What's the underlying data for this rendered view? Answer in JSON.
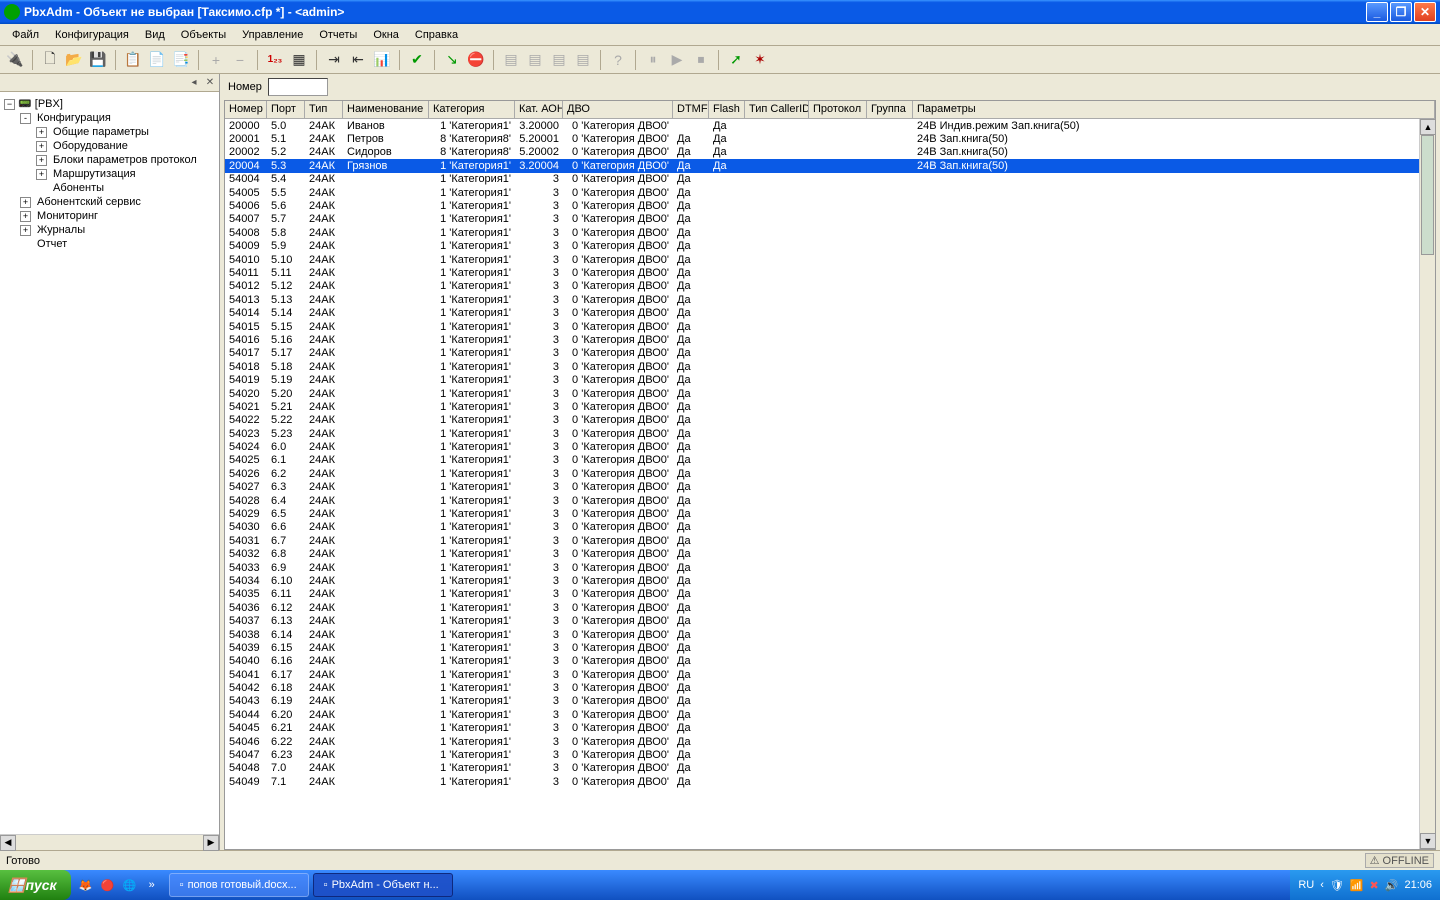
{
  "window": {
    "title": "PbxAdm  -  Объект не выбран [Таксимо.cfp *]   - <admin>"
  },
  "menu": {
    "items": [
      "Файл",
      "Конфигурация",
      "Вид",
      "Объекты",
      "Управление",
      "Отчеты",
      "Окна",
      "Справка"
    ]
  },
  "tree": {
    "root": "[PBX]",
    "nodes": [
      {
        "d": 1,
        "exp": "-",
        "label": "Конфигурация"
      },
      {
        "d": 2,
        "exp": "+",
        "label": "Общие параметры"
      },
      {
        "d": 2,
        "exp": "+",
        "label": "Оборудование"
      },
      {
        "d": 2,
        "exp": "+",
        "label": "Блоки параметров протокол"
      },
      {
        "d": 2,
        "exp": "+",
        "label": "Маршрутизация"
      },
      {
        "d": 2,
        "exp": "",
        "label": "Абоненты"
      },
      {
        "d": 1,
        "exp": "+",
        "label": "Абонентский сервис"
      },
      {
        "d": 1,
        "exp": "+",
        "label": "Мониторинг"
      },
      {
        "d": 1,
        "exp": "+",
        "label": "Журналы"
      },
      {
        "d": 1,
        "exp": "",
        "label": "Отчет"
      }
    ]
  },
  "filter": {
    "label": "Номер",
    "value": ""
  },
  "grid": {
    "columns": [
      "Номер",
      "Порт",
      "Тип",
      "Наименование",
      "Категория",
      "Кат. АОН",
      "ДВО",
      "DTMF",
      "Flash",
      "Тип CallerID",
      "Протокол",
      "Группа",
      "Параметры"
    ],
    "selected_index": 3,
    "rows": [
      {
        "nom": "20000",
        "por": "5.0",
        "tip": "24АК",
        "nam": "Иванов",
        "kat": "1 'Категория1'",
        "aon": "3.20000",
        "dvo": "0 'Категория ДВО0'",
        "dtm": "",
        "fla": "Да",
        "par": "24В  Индив.режим Зап.книга(50)"
      },
      {
        "nom": "20001",
        "por": "5.1",
        "tip": "24АК",
        "nam": "Петров",
        "kat": "8 'Категория8'",
        "aon": "5.20001",
        "dvo": "0 'Категория ДВО0'",
        "dtm": "Да",
        "fla": "Да",
        "par": "24В  Зап.книга(50)"
      },
      {
        "nom": "20002",
        "por": "5.2",
        "tip": "24АК",
        "nam": "Сидоров",
        "kat": "8 'Категория8'",
        "aon": "5.20002",
        "dvo": "0 'Категория ДВО0'",
        "dtm": "Да",
        "fla": "Да",
        "par": "24В  Зап.книга(50)"
      },
      {
        "nom": "20004",
        "por": "5.3",
        "tip": "24АК",
        "nam": "Грязнов",
        "kat": "1 'Категория1'",
        "aon": "3.20004",
        "dvo": "0 'Категория ДВО0'",
        "dtm": "Да",
        "fla": "Да",
        "par": "24В  Зап.книга(50)"
      },
      {
        "nom": "54004",
        "por": "5.4",
        "tip": "24АК",
        "nam": "",
        "kat": "1 'Категория1'",
        "aon": "3",
        "dvo": "0 'Категория ДВО0'",
        "dtm": "Да",
        "fla": "",
        "par": ""
      },
      {
        "nom": "54005",
        "por": "5.5",
        "tip": "24АК",
        "nam": "",
        "kat": "1 'Категория1'",
        "aon": "3",
        "dvo": "0 'Категория ДВО0'",
        "dtm": "Да",
        "fla": "",
        "par": ""
      },
      {
        "nom": "54006",
        "por": "5.6",
        "tip": "24АК",
        "nam": "",
        "kat": "1 'Категория1'",
        "aon": "3",
        "dvo": "0 'Категория ДВО0'",
        "dtm": "Да",
        "fla": "",
        "par": ""
      },
      {
        "nom": "54007",
        "por": "5.7",
        "tip": "24АК",
        "nam": "",
        "kat": "1 'Категория1'",
        "aon": "3",
        "dvo": "0 'Категория ДВО0'",
        "dtm": "Да",
        "fla": "",
        "par": ""
      },
      {
        "nom": "54008",
        "por": "5.8",
        "tip": "24АК",
        "nam": "",
        "kat": "1 'Категория1'",
        "aon": "3",
        "dvo": "0 'Категория ДВО0'",
        "dtm": "Да",
        "fla": "",
        "par": ""
      },
      {
        "nom": "54009",
        "por": "5.9",
        "tip": "24АК",
        "nam": "",
        "kat": "1 'Категория1'",
        "aon": "3",
        "dvo": "0 'Категория ДВО0'",
        "dtm": "Да",
        "fla": "",
        "par": ""
      },
      {
        "nom": "54010",
        "por": "5.10",
        "tip": "24АК",
        "nam": "",
        "kat": "1 'Категория1'",
        "aon": "3",
        "dvo": "0 'Категория ДВО0'",
        "dtm": "Да",
        "fla": "",
        "par": ""
      },
      {
        "nom": "54011",
        "por": "5.11",
        "tip": "24АК",
        "nam": "",
        "kat": "1 'Категория1'",
        "aon": "3",
        "dvo": "0 'Категория ДВО0'",
        "dtm": "Да",
        "fla": "",
        "par": ""
      },
      {
        "nom": "54012",
        "por": "5.12",
        "tip": "24АК",
        "nam": "",
        "kat": "1 'Категория1'",
        "aon": "3",
        "dvo": "0 'Категория ДВО0'",
        "dtm": "Да",
        "fla": "",
        "par": ""
      },
      {
        "nom": "54013",
        "por": "5.13",
        "tip": "24АК",
        "nam": "",
        "kat": "1 'Категория1'",
        "aon": "3",
        "dvo": "0 'Категория ДВО0'",
        "dtm": "Да",
        "fla": "",
        "par": ""
      },
      {
        "nom": "54014",
        "por": "5.14",
        "tip": "24АК",
        "nam": "",
        "kat": "1 'Категория1'",
        "aon": "3",
        "dvo": "0 'Категория ДВО0'",
        "dtm": "Да",
        "fla": "",
        "par": ""
      },
      {
        "nom": "54015",
        "por": "5.15",
        "tip": "24АК",
        "nam": "",
        "kat": "1 'Категория1'",
        "aon": "3",
        "dvo": "0 'Категория ДВО0'",
        "dtm": "Да",
        "fla": "",
        "par": ""
      },
      {
        "nom": "54016",
        "por": "5.16",
        "tip": "24АК",
        "nam": "",
        "kat": "1 'Категория1'",
        "aon": "3",
        "dvo": "0 'Категория ДВО0'",
        "dtm": "Да",
        "fla": "",
        "par": ""
      },
      {
        "nom": "54017",
        "por": "5.17",
        "tip": "24АК",
        "nam": "",
        "kat": "1 'Категория1'",
        "aon": "3",
        "dvo": "0 'Категория ДВО0'",
        "dtm": "Да",
        "fla": "",
        "par": ""
      },
      {
        "nom": "54018",
        "por": "5.18",
        "tip": "24АК",
        "nam": "",
        "kat": "1 'Категория1'",
        "aon": "3",
        "dvo": "0 'Категория ДВО0'",
        "dtm": "Да",
        "fla": "",
        "par": ""
      },
      {
        "nom": "54019",
        "por": "5.19",
        "tip": "24АК",
        "nam": "",
        "kat": "1 'Категория1'",
        "aon": "3",
        "dvo": "0 'Категория ДВО0'",
        "dtm": "Да",
        "fla": "",
        "par": ""
      },
      {
        "nom": "54020",
        "por": "5.20",
        "tip": "24АК",
        "nam": "",
        "kat": "1 'Категория1'",
        "aon": "3",
        "dvo": "0 'Категория ДВО0'",
        "dtm": "Да",
        "fla": "",
        "par": ""
      },
      {
        "nom": "54021",
        "por": "5.21",
        "tip": "24АК",
        "nam": "",
        "kat": "1 'Категория1'",
        "aon": "3",
        "dvo": "0 'Категория ДВО0'",
        "dtm": "Да",
        "fla": "",
        "par": ""
      },
      {
        "nom": "54022",
        "por": "5.22",
        "tip": "24АК",
        "nam": "",
        "kat": "1 'Категория1'",
        "aon": "3",
        "dvo": "0 'Категория ДВО0'",
        "dtm": "Да",
        "fla": "",
        "par": ""
      },
      {
        "nom": "54023",
        "por": "5.23",
        "tip": "24АК",
        "nam": "",
        "kat": "1 'Категория1'",
        "aon": "3",
        "dvo": "0 'Категория ДВО0'",
        "dtm": "Да",
        "fla": "",
        "par": ""
      },
      {
        "nom": "54024",
        "por": "6.0",
        "tip": "24АК",
        "nam": "",
        "kat": "1 'Категория1'",
        "aon": "3",
        "dvo": "0 'Категория ДВО0'",
        "dtm": "Да",
        "fla": "",
        "par": ""
      },
      {
        "nom": "54025",
        "por": "6.1",
        "tip": "24АК",
        "nam": "",
        "kat": "1 'Категория1'",
        "aon": "3",
        "dvo": "0 'Категория ДВО0'",
        "dtm": "Да",
        "fla": "",
        "par": ""
      },
      {
        "nom": "54026",
        "por": "6.2",
        "tip": "24АК",
        "nam": "",
        "kat": "1 'Категория1'",
        "aon": "3",
        "dvo": "0 'Категория ДВО0'",
        "dtm": "Да",
        "fla": "",
        "par": ""
      },
      {
        "nom": "54027",
        "por": "6.3",
        "tip": "24АК",
        "nam": "",
        "kat": "1 'Категория1'",
        "aon": "3",
        "dvo": "0 'Категория ДВО0'",
        "dtm": "Да",
        "fla": "",
        "par": ""
      },
      {
        "nom": "54028",
        "por": "6.4",
        "tip": "24АК",
        "nam": "",
        "kat": "1 'Категория1'",
        "aon": "3",
        "dvo": "0 'Категория ДВО0'",
        "dtm": "Да",
        "fla": "",
        "par": ""
      },
      {
        "nom": "54029",
        "por": "6.5",
        "tip": "24АК",
        "nam": "",
        "kat": "1 'Категория1'",
        "aon": "3",
        "dvo": "0 'Категория ДВО0'",
        "dtm": "Да",
        "fla": "",
        "par": ""
      },
      {
        "nom": "54030",
        "por": "6.6",
        "tip": "24АК",
        "nam": "",
        "kat": "1 'Категория1'",
        "aon": "3",
        "dvo": "0 'Категория ДВО0'",
        "dtm": "Да",
        "fla": "",
        "par": ""
      },
      {
        "nom": "54031",
        "por": "6.7",
        "tip": "24АК",
        "nam": "",
        "kat": "1 'Категория1'",
        "aon": "3",
        "dvo": "0 'Категория ДВО0'",
        "dtm": "Да",
        "fla": "",
        "par": ""
      },
      {
        "nom": "54032",
        "por": "6.8",
        "tip": "24АК",
        "nam": "",
        "kat": "1 'Категория1'",
        "aon": "3",
        "dvo": "0 'Категория ДВО0'",
        "dtm": "Да",
        "fla": "",
        "par": ""
      },
      {
        "nom": "54033",
        "por": "6.9",
        "tip": "24АК",
        "nam": "",
        "kat": "1 'Категория1'",
        "aon": "3",
        "dvo": "0 'Категория ДВО0'",
        "dtm": "Да",
        "fla": "",
        "par": ""
      },
      {
        "nom": "54034",
        "por": "6.10",
        "tip": "24АК",
        "nam": "",
        "kat": "1 'Категория1'",
        "aon": "3",
        "dvo": "0 'Категория ДВО0'",
        "dtm": "Да",
        "fla": "",
        "par": ""
      },
      {
        "nom": "54035",
        "por": "6.11",
        "tip": "24АК",
        "nam": "",
        "kat": "1 'Категория1'",
        "aon": "3",
        "dvo": "0 'Категория ДВО0'",
        "dtm": "Да",
        "fla": "",
        "par": ""
      },
      {
        "nom": "54036",
        "por": "6.12",
        "tip": "24АК",
        "nam": "",
        "kat": "1 'Категория1'",
        "aon": "3",
        "dvo": "0 'Категория ДВО0'",
        "dtm": "Да",
        "fla": "",
        "par": ""
      },
      {
        "nom": "54037",
        "por": "6.13",
        "tip": "24АК",
        "nam": "",
        "kat": "1 'Категория1'",
        "aon": "3",
        "dvo": "0 'Категория ДВО0'",
        "dtm": "Да",
        "fla": "",
        "par": ""
      },
      {
        "nom": "54038",
        "por": "6.14",
        "tip": "24АК",
        "nam": "",
        "kat": "1 'Категория1'",
        "aon": "3",
        "dvo": "0 'Категория ДВО0'",
        "dtm": "Да",
        "fla": "",
        "par": ""
      },
      {
        "nom": "54039",
        "por": "6.15",
        "tip": "24АК",
        "nam": "",
        "kat": "1 'Категория1'",
        "aon": "3",
        "dvo": "0 'Категория ДВО0'",
        "dtm": "Да",
        "fla": "",
        "par": ""
      },
      {
        "nom": "54040",
        "por": "6.16",
        "tip": "24АК",
        "nam": "",
        "kat": "1 'Категория1'",
        "aon": "3",
        "dvo": "0 'Категория ДВО0'",
        "dtm": "Да",
        "fla": "",
        "par": ""
      },
      {
        "nom": "54041",
        "por": "6.17",
        "tip": "24АК",
        "nam": "",
        "kat": "1 'Категория1'",
        "aon": "3",
        "dvo": "0 'Категория ДВО0'",
        "dtm": "Да",
        "fla": "",
        "par": ""
      },
      {
        "nom": "54042",
        "por": "6.18",
        "tip": "24АК",
        "nam": "",
        "kat": "1 'Категория1'",
        "aon": "3",
        "dvo": "0 'Категория ДВО0'",
        "dtm": "Да",
        "fla": "",
        "par": ""
      },
      {
        "nom": "54043",
        "por": "6.19",
        "tip": "24АК",
        "nam": "",
        "kat": "1 'Категория1'",
        "aon": "3",
        "dvo": "0 'Категория ДВО0'",
        "dtm": "Да",
        "fla": "",
        "par": ""
      },
      {
        "nom": "54044",
        "por": "6.20",
        "tip": "24АК",
        "nam": "",
        "kat": "1 'Категория1'",
        "aon": "3",
        "dvo": "0 'Категория ДВО0'",
        "dtm": "Да",
        "fla": "",
        "par": ""
      },
      {
        "nom": "54045",
        "por": "6.21",
        "tip": "24АК",
        "nam": "",
        "kat": "1 'Категория1'",
        "aon": "3",
        "dvo": "0 'Категория ДВО0'",
        "dtm": "Да",
        "fla": "",
        "par": ""
      },
      {
        "nom": "54046",
        "por": "6.22",
        "tip": "24АК",
        "nam": "",
        "kat": "1 'Категория1'",
        "aon": "3",
        "dvo": "0 'Категория ДВО0'",
        "dtm": "Да",
        "fla": "",
        "par": ""
      },
      {
        "nom": "54047",
        "por": "6.23",
        "tip": "24АК",
        "nam": "",
        "kat": "1 'Категория1'",
        "aon": "3",
        "dvo": "0 'Категория ДВО0'",
        "dtm": "Да",
        "fla": "",
        "par": ""
      },
      {
        "nom": "54048",
        "por": "7.0",
        "tip": "24АК",
        "nam": "",
        "kat": "1 'Категория1'",
        "aon": "3",
        "dvo": "0 'Категория ДВО0'",
        "dtm": "Да",
        "fla": "",
        "par": ""
      },
      {
        "nom": "54049",
        "por": "7.1",
        "tip": "24АК",
        "nam": "",
        "kat": "1 'Категория1'",
        "aon": "3",
        "dvo": "0 'Категория ДВО0'",
        "dtm": "Да",
        "fla": "",
        "par": ""
      }
    ]
  },
  "status": {
    "left": "Готово",
    "lang": "RU",
    "offline": "OFFLINE"
  },
  "taskbar": {
    "start": "пуск",
    "tasks": [
      {
        "label": "попов готовый.docx...",
        "active": false
      },
      {
        "label": "PbxAdm  -  Объект н...",
        "active": true
      }
    ],
    "clock": "21:06"
  }
}
